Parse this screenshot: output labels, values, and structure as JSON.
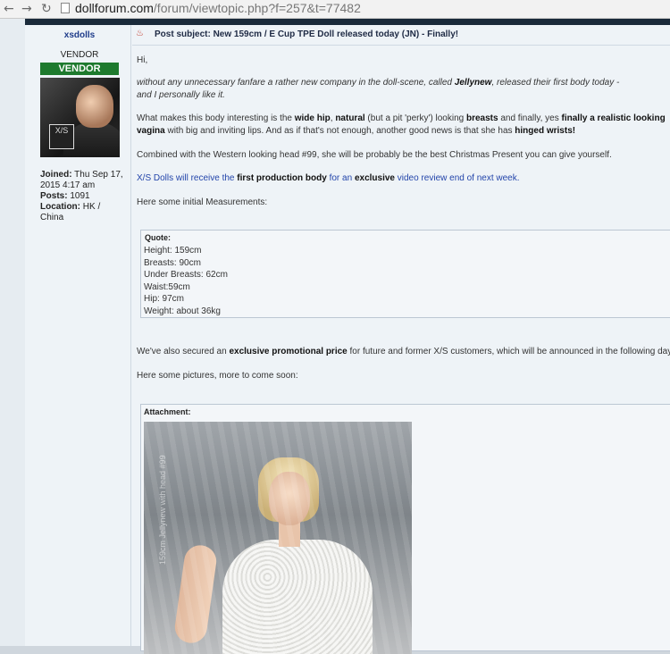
{
  "browser": {
    "back_icon": "arrow-left-icon",
    "forward_icon": "arrow-right-icon",
    "reload_icon": "reload-icon",
    "url_domain": "dollforum.com",
    "url_path": "/forum/viewtopic.php?f=257&t=77482"
  },
  "profile": {
    "username": "xsdolls",
    "rank_text": "VENDOR",
    "rank_badge": "VENDOR",
    "avatar_logo": "X/S",
    "joined_label": "Joined:",
    "joined_value": "Thu Sep 17, 2015 4:17 am",
    "posts_label": "Posts:",
    "posts_value": "1091",
    "location_label": "Location:",
    "location_value": "HK / China"
  },
  "post": {
    "subject_label": "Post subject:",
    "subject": "New 159cm / E Cup TPE Doll released today (JN) - Finally!",
    "greeting": "Hi,",
    "p1_a": "without any unnecessary fanfare a rather new company in the doll-scene, called ",
    "p1_b": "Jellynew",
    "p1_c": ", released their first body today -",
    "p1_d": "and I personally like it.",
    "p2_a": "What makes this body interesting is the ",
    "p2_b": "wide hip",
    "p2_c": ", ",
    "p2_d": "natural",
    "p2_e": " (but a pit 'perky') looking ",
    "p2_f": "breasts",
    "p2_g": " and finally, yes ",
    "p2_h": "finally a realistic looking vagina",
    "p2_i": " with big and inviting lips. And as if that's not enough, another good news is that she has ",
    "p2_j": "hinged wrists!",
    "p3": "Combined with the Western looking head #99, she will be probably be the best Christmas Present you can give yourself.",
    "p4_a": "X/S Dolls will receive the ",
    "p4_b": "first production body",
    "p4_c": " for an ",
    "p4_d": "exclusive",
    "p4_e": " video review end of next week.",
    "p5": "Here some initial Measurements:",
    "quote_title": "Quote:",
    "quote_lines": [
      "Height: 159cm",
      "Breasts: 90cm",
      "Under Breasts: 62cm",
      "Waist:59cm",
      "Hip: 97cm",
      "Weight: about 36kg"
    ],
    "p6_a": "We've also secured an ",
    "p6_b": "exclusive promotional price",
    "p6_c": " for future and former X/S customers, which will be announced in the following days",
    "p7": "Here some pictures, more to come soon:",
    "attachment_title": "Attachment:",
    "photo_watermark": "159cm Jellynew with head #99"
  }
}
